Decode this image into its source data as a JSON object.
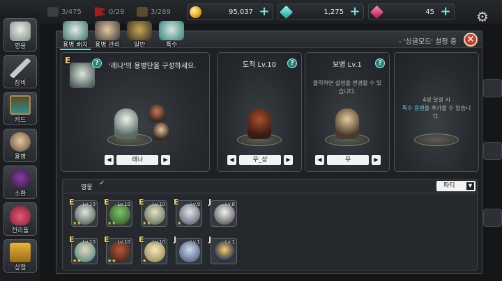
{
  "topbar": {
    "stat1": "3/475",
    "stat2": "0/29",
    "stat3": "3/289",
    "gold": "95,037",
    "gem_teal": "1,275",
    "gem_red": "45"
  },
  "leftnav": {
    "items": [
      "영웅",
      "장비",
      "카드",
      "용병",
      "소환",
      "전리품",
      "상점"
    ]
  },
  "panel": {
    "mode_note": "- '싱글모드' 설정 중",
    "tabs": [
      "용병 배치",
      "용병 관리",
      "일반",
      "특수"
    ]
  },
  "slots": {
    "hero": {
      "grade": "E",
      "title": "'레나'의 용병단을 구성하세요.",
      "selected": "레나"
    },
    "thief": {
      "title": "도적 Lv.10",
      "selected": "우_상"
    },
    "infantry": {
      "title": "보병 Lv.1",
      "desc": "클릭하면 설정을 변경할 수 있습니다.",
      "selected": "우"
    },
    "locked": {
      "desc_pre": "4성 달성 시",
      "desc_highlight": "특수 용병",
      "desc_post": "을 추가할 수 있습니다."
    }
  },
  "list": {
    "tab_label": "영웅",
    "party_label": "파티",
    "cards": [
      {
        "grade": "E",
        "lv": "Lv.10",
        "stars": "★★"
      },
      {
        "grade": "E",
        "lv": "Lv.10",
        "stars": "★★"
      },
      {
        "grade": "E",
        "lv": "Lv.10",
        "stars": "★★"
      },
      {
        "grade": "E",
        "lv": "Lv.9",
        "stars": "★"
      },
      {
        "grade": "J",
        "lv": "Lv.8",
        "stars": ""
      },
      {
        "grade": "E",
        "lv": "Lv.10",
        "stars": "★★"
      },
      {
        "grade": "E",
        "lv": "Lv.10",
        "stars": "★★"
      },
      {
        "grade": "E",
        "lv": "Lv.10",
        "stars": "★"
      },
      {
        "grade": "J",
        "lv": "Lv.1",
        "stars": ""
      },
      {
        "grade": "J",
        "lv": "Lv.1",
        "stars": ""
      }
    ]
  },
  "colors": {
    "accent_teal": "#2d7f7a",
    "highlight_text": "#5fd4e6",
    "close_red": "#c6402f",
    "gold": "#f2d46a"
  }
}
